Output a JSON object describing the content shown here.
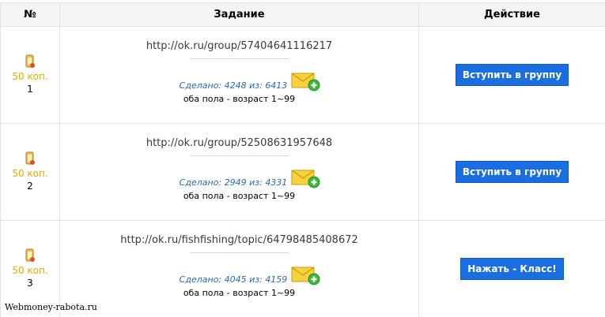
{
  "header": {
    "col_num": "№",
    "col_task": "Задание",
    "col_action": "Действие"
  },
  "rows": [
    {
      "price": "50 коп.",
      "num": "1",
      "link": "http://ok.ru/group/57404641116217",
      "done": "Сделано: 4248 из: 6413",
      "audience": "оба пола - возраст 1~99",
      "action": "Вступить в группу"
    },
    {
      "price": "50 коп.",
      "num": "2",
      "link": "http://ok.ru/group/52508631957648",
      "done": "Сделано: 2949 из: 4331",
      "audience": "оба пола - возраст 1~99",
      "action": "Вступить в группу"
    },
    {
      "price": "50 коп.",
      "num": "3",
      "link": "http://ok.ru/fishfishing/topic/64798485408672",
      "done": "Сделано: 4045 из: 4159",
      "audience": "оба пола - возраст 1~99",
      "action": "Нажать - Класс!"
    }
  ],
  "watermark": "Webmoney-rabota.ru",
  "icons": {
    "coin": "coin-icon",
    "mail_add": "mail-add-icon"
  },
  "colors": {
    "price": "#e8a800",
    "button": "#1b6ee0",
    "done_text": "#2b6aa8",
    "add_badge": "#3cb83c"
  }
}
